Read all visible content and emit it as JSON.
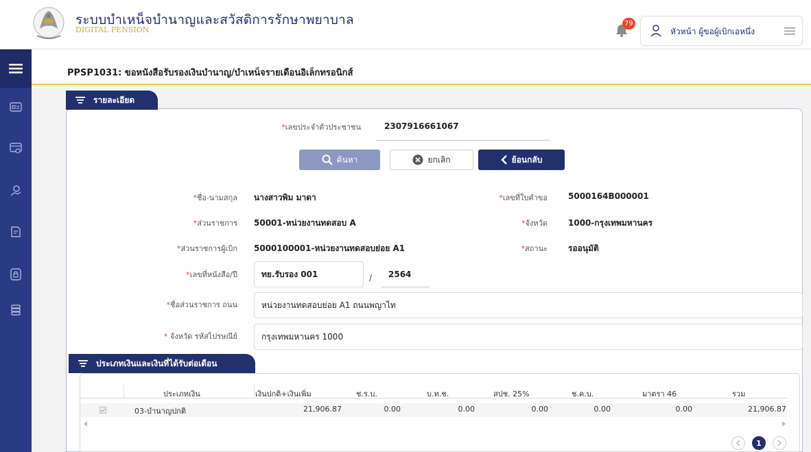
{
  "header": {
    "title": "ระบบบำเหน็จบำนาญและสวัสดิการรักษาพยาบาล",
    "subtitle": "DIGITAL PENSION",
    "notification_count": "79",
    "user_name": "หัวหน้า ผู้ขอผู้เบิกเอหนึ่ง"
  },
  "page": {
    "title": "PPSP1031: ขอหนังสือรับรองเงินบำนาญ/บำเหน็จรายเดือนอิเล็กทรอนิกส์"
  },
  "detail_tab": {
    "label": "รายละเอียด"
  },
  "search": {
    "id_label": "เลขประจำตัวประชาชน",
    "id_value": "2307916661067",
    "search_button": "ค้นหา",
    "cancel_button": "ยกเลิก",
    "back_button": "ย้อนกลับ"
  },
  "form": {
    "name_label": "ชื่อ-นามสกุล",
    "name_value": "นางสาวพิม มาดา",
    "request_no_label": "เลขที่ใบคำขอ",
    "request_no_value": "5000164B000001",
    "agency_label": "ส่วนราชการ",
    "agency_value": "50001-หน่วยงานทดสอบ A",
    "province_label": "จังหวัด",
    "province_value": "1000-กรุงเทพมหานคร",
    "disbursing_label": "ส่วนราชการผู้เบิก",
    "disbursing_value": "5000100001-หน่วยงานทดสอบย่อย A1",
    "status_label": "สถานะ",
    "status_value": "รออนุมัติ",
    "letter_no_label": "เลขที่หนังสือ/ปี",
    "letter_no_value": "ทย.รับรอง 001",
    "letter_sep": "/",
    "letter_year_value": "2564",
    "agency_road_label": "ชื่อส่วนราชการ ถนน",
    "agency_road_value": "หน่วยงานทดสอบย่อย A1 ถนนพญาไท",
    "province_zip_label": " จังหวัด รหัสไปรษณีย์",
    "province_zip_value": "กรุงเทพมหานคร 1000"
  },
  "income_tab": {
    "label": "ประเภทเงินและเงินที่ได้รับต่อเดือน"
  },
  "table": {
    "columns": [
      "ประเภทเงิน",
      "เงินปกติ+เงินเพิ่ม",
      "ช.ร.บ.",
      "บ.ท.ช.",
      "สปช. 25%",
      "ช.ค.บ.",
      "มาตรา 46",
      "รวม"
    ],
    "rows": [
      [
        "03-บำนาญปกติ",
        "21,906.87",
        "0.00",
        "0.00",
        "0.00",
        "0.00",
        "0.00",
        "21,906.87"
      ]
    ]
  },
  "pager": {
    "current": "1"
  },
  "colors": {
    "primary": "#23306e",
    "accent": "#f2c94c",
    "required": "#e3472a"
  }
}
